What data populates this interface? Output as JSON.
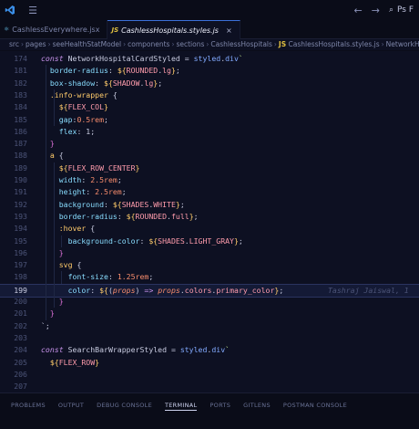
{
  "titlebar": {
    "search_text": "Ps F",
    "colors": {
      "accent": "#3b6fd8",
      "bg": "#0a0c18"
    }
  },
  "tabs": [
    {
      "label": "CashlessEverywhere.jsx",
      "icon": "react-file-icon",
      "active": false
    },
    {
      "label": "CashlessHospitals.styles.js",
      "icon": "js-file-icon",
      "active": true,
      "close": "×"
    }
  ],
  "breadcrumb": {
    "segments": [
      "src",
      "pages",
      "seeHealthStatModel",
      "components",
      "sections",
      "CashlessHospitals"
    ],
    "file": "CashlessHospitals.styles.js",
    "symbol": "NetworkHosp"
  },
  "editor": {
    "current_line": "199",
    "blame_text": "Tashraj Jaiswal, 1",
    "lines": [
      {
        "n": "174",
        "t": "const NetworkHospitalCardStyled = styled.div`"
      },
      {
        "n": "181",
        "t": "  border-radius: ${ROUNDED.lg};"
      },
      {
        "n": "182",
        "t": "  box-shadow: ${SHADOW.lg};"
      },
      {
        "n": "183",
        "t": "  .info-wrapper {"
      },
      {
        "n": "184",
        "t": "    ${FLEX_COL}"
      },
      {
        "n": "185",
        "t": "    gap:0.5rem;"
      },
      {
        "n": "186",
        "t": "    flex: 1;"
      },
      {
        "n": "187",
        "t": "  }"
      },
      {
        "n": "188",
        "t": "  a {"
      },
      {
        "n": "189",
        "t": "    ${FLEX_ROW_CENTER}"
      },
      {
        "n": "190",
        "t": "    width: 2.5rem;"
      },
      {
        "n": "191",
        "t": "    height: 2.5rem;"
      },
      {
        "n": "192",
        "t": "    background: ${SHADES.WHITE};"
      },
      {
        "n": "193",
        "t": "    border-radius: ${ROUNDED.full};"
      },
      {
        "n": "194",
        "t": "    :hover {"
      },
      {
        "n": "195",
        "t": "      background-color: ${SHADES.LIGHT_GRAY};"
      },
      {
        "n": "196",
        "t": "    }"
      },
      {
        "n": "197",
        "t": "    svg {"
      },
      {
        "n": "198",
        "t": "      font-size: 1.25rem;"
      },
      {
        "n": "199",
        "t": "      color: ${(props) => props.colors.primary_color};"
      },
      {
        "n": "200",
        "t": "    }"
      },
      {
        "n": "201",
        "t": "  }"
      },
      {
        "n": "202",
        "t": "`;"
      },
      {
        "n": "203",
        "t": ""
      },
      {
        "n": "204",
        "t": "const SearchBarWrapperStyled = styled.div`"
      },
      {
        "n": "205",
        "t": "  ${FLEX_ROW}"
      },
      {
        "n": "206",
        "t": ""
      },
      {
        "n": "207",
        "t": ""
      }
    ]
  },
  "panel": {
    "tabs": [
      "PROBLEMS",
      "OUTPUT",
      "DEBUG CONSOLE",
      "TERMINAL",
      "PORTS",
      "GITLENS",
      "POSTMAN CONSOLE"
    ],
    "active": "TERMINAL"
  }
}
